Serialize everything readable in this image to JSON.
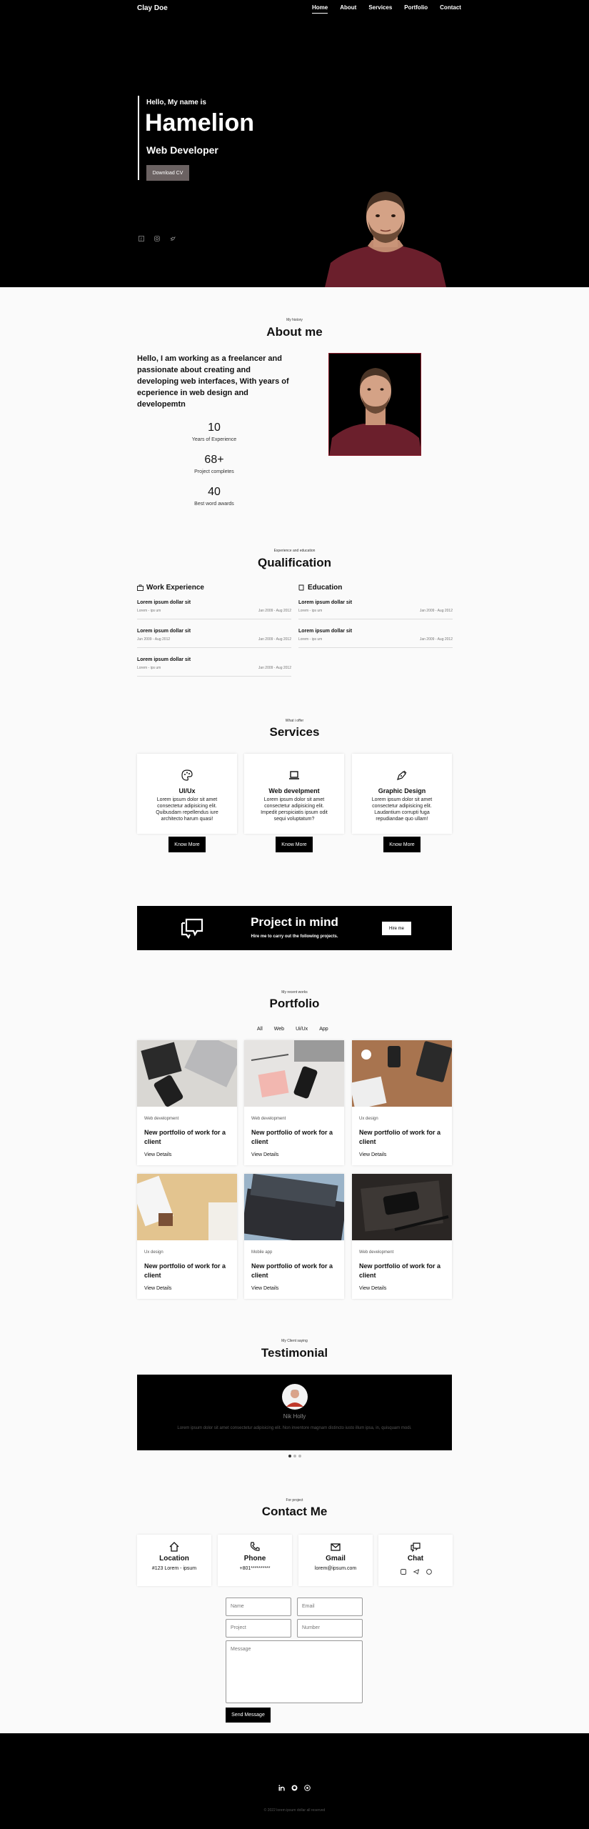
{
  "header": {
    "brand": "Clay Doe",
    "nav": [
      "Home",
      "About",
      "Services",
      "Portfolio",
      "Contact"
    ]
  },
  "hero": {
    "greeting": "Hello, My name is",
    "name": "Hamelion",
    "role": "Web Developer",
    "cv_button": "Download CV",
    "social_icons": [
      "facebook-icon",
      "instagram-icon",
      "twitter-icon"
    ]
  },
  "about": {
    "kicker": "My history",
    "title": "About me",
    "text": "Hello, I am working as a freelancer and passionate about creating and developing web interfaces, With years of ecperience in web design and developemtn",
    "stats": [
      {
        "num": "10",
        "label": "Years of Experience"
      },
      {
        "num": "68+",
        "label": "Project completes"
      },
      {
        "num": "40",
        "label": "Best word awards"
      }
    ]
  },
  "qualification": {
    "kicker": "Experience and education",
    "title": "Qualification",
    "work_title": "Work Experience",
    "education_title": "Education",
    "work": [
      {
        "title": "Lorem ipsum dollar sit",
        "place": "Lorem - ips um",
        "date": "Jan 2009 - Aug 2012"
      },
      {
        "title": "Lorem ipsum dollar sit",
        "place": "Jun 2009 - Aug 2012",
        "date": "Jan 2009 - Aug 2012"
      },
      {
        "title": "Lorem ipsum dollar sit",
        "place": "Lorem - ips um",
        "date": "Jan 2009 - Aug 2012"
      }
    ],
    "education": [
      {
        "title": "Lorem ipsum dollar sit",
        "place": "Lorem - ips um",
        "date": "Jan 2009 - Aug 2012"
      },
      {
        "title": "Lorem ipsum dollar sit",
        "place": "Lorem - ips um",
        "date": "Jan 2009 - Aug 2012"
      }
    ]
  },
  "services": {
    "kicker": "What i offer",
    "title": "Services",
    "button": "Know More",
    "items": [
      {
        "icon": "palette-icon",
        "title": "UI/Ux",
        "desc": "Lorem ipsum dolor sit amet consectetur adipisicing elit. Quibusdam repellendus iure architecto harum quasi!"
      },
      {
        "icon": "laptop-icon",
        "title": "Web develpment",
        "desc": "Lorem ipsum dolor sit amet consectetur adipisicing elit. Impedit perspiciatis ipsum odit sequi voluptatum?"
      },
      {
        "icon": "pen-tool-icon",
        "title": "Graphic Design",
        "desc": "Lorem ipsum dolor sit amet consectetur adipisicing elit. Laudantium corrupti fuga repudiandae quo ullam!"
      }
    ]
  },
  "project": {
    "title": "Project in mind",
    "subtitle": "Hire me to carry out the following projects.",
    "button": "Hire me"
  },
  "portfolio": {
    "kicker": "My recent works",
    "title": "Portfolio",
    "filters": [
      "All",
      "Web",
      "Ui/Ux",
      "App"
    ],
    "link": "View Details",
    "items": [
      {
        "category": "Web development",
        "title": "New portfolio of work for a client"
      },
      {
        "category": "Web development",
        "title": "New portfolio of work for a client"
      },
      {
        "category": "Ux design",
        "title": "New portfolio of work for a client"
      },
      {
        "category": "Ux design",
        "title": "New portfolio of work for a client"
      },
      {
        "category": "Mobile app",
        "title": "New portfolio of work for a client"
      },
      {
        "category": "Web development",
        "title": "New portfolio of work for a client"
      }
    ]
  },
  "testimonial": {
    "kicker": "My Client saying",
    "title": "Testimonial",
    "name": "Nik Holly",
    "quote": "Lorem ipsum dolor sit amet consectetur adipisicing elit. Non inventore magnam distincto iusto illum ipsa, in, quisquam modi."
  },
  "contact": {
    "kicker": "For project",
    "title": "Contact Me",
    "cards": [
      {
        "icon": "home-icon",
        "title": "Location",
        "value": "#123 Lorem - ipsum"
      },
      {
        "icon": "phone-icon",
        "title": "Phone",
        "value": "+801**********"
      },
      {
        "icon": "mail-icon",
        "title": "Gmail",
        "value": "lorem@ipsum.com"
      },
      {
        "icon": "chat-icon",
        "title": "Chat",
        "value": ""
      }
    ],
    "chat_icons": [
      "whatsapp-icon",
      "telegram-icon",
      "messenger-icon"
    ],
    "form": {
      "name": "Name",
      "email": "Email",
      "project": "Project",
      "number": "Number",
      "message": "Message",
      "send": "Send Message"
    }
  },
  "footer": {
    "icons": [
      "linkedin-icon",
      "github-icon",
      "dribbble-icon"
    ],
    "copyright": "© 2022 lorem ipsum dollar all reserved"
  }
}
